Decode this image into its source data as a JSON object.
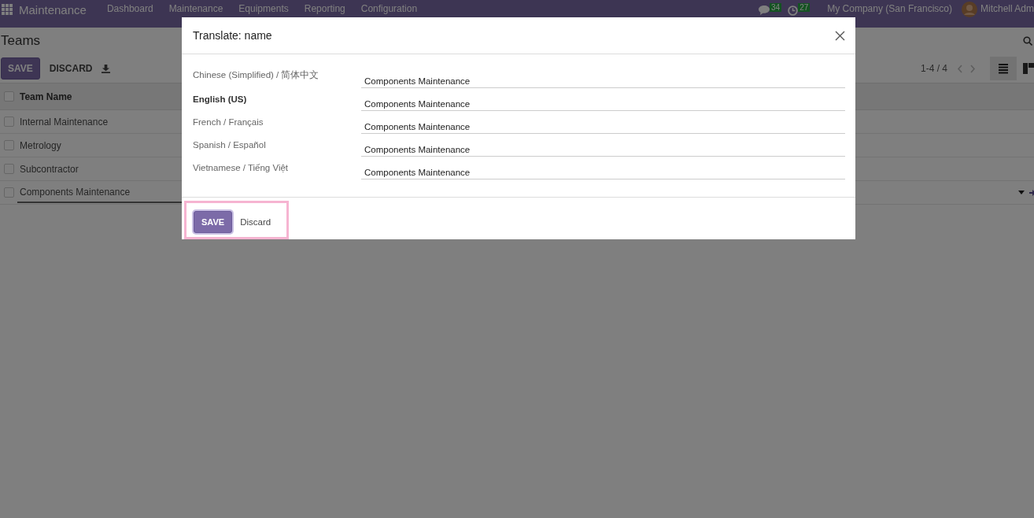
{
  "navbar": {
    "app_name": "Maintenance",
    "menu": [
      "Dashboard",
      "Maintenance",
      "Equipments",
      "Reporting",
      "Configuration"
    ],
    "messages_count": "34",
    "activities_count": "27",
    "company": "My Company (San Francisco)",
    "user": "Mitchell Adm"
  },
  "control_panel": {
    "title": "Teams",
    "save_label": "SAVE",
    "discard_label": "DISCARD",
    "pager": "1-4 / 4"
  },
  "list": {
    "header": {
      "label": "Team Name",
      "checked": false
    },
    "rows": [
      {
        "name": "Internal Maintenance",
        "checked": false,
        "editing": false
      },
      {
        "name": "Metrology",
        "checked": false,
        "editing": false
      },
      {
        "name": "Subcontractor",
        "checked": false,
        "editing": false
      },
      {
        "name": "Components Maintenance",
        "checked": false,
        "editing": true
      }
    ]
  },
  "dialog": {
    "title": "Translate: name",
    "translations": [
      {
        "language": "Chinese (Simplified) / 简体中文",
        "value": "Components Maintenance",
        "current": false
      },
      {
        "language": "English (US)",
        "value": "Components Maintenance",
        "current": true
      },
      {
        "language": "French / Français",
        "value": "Components Maintenance",
        "current": false
      },
      {
        "language": "Spanish / Español",
        "value": "Components Maintenance",
        "current": false
      },
      {
        "language": "Vietnamese / Tiếng Việt",
        "value": "Components Maintenance",
        "current": false
      }
    ],
    "save_label": "SAVE",
    "discard_label": "Discard",
    "highlighted": true
  }
}
